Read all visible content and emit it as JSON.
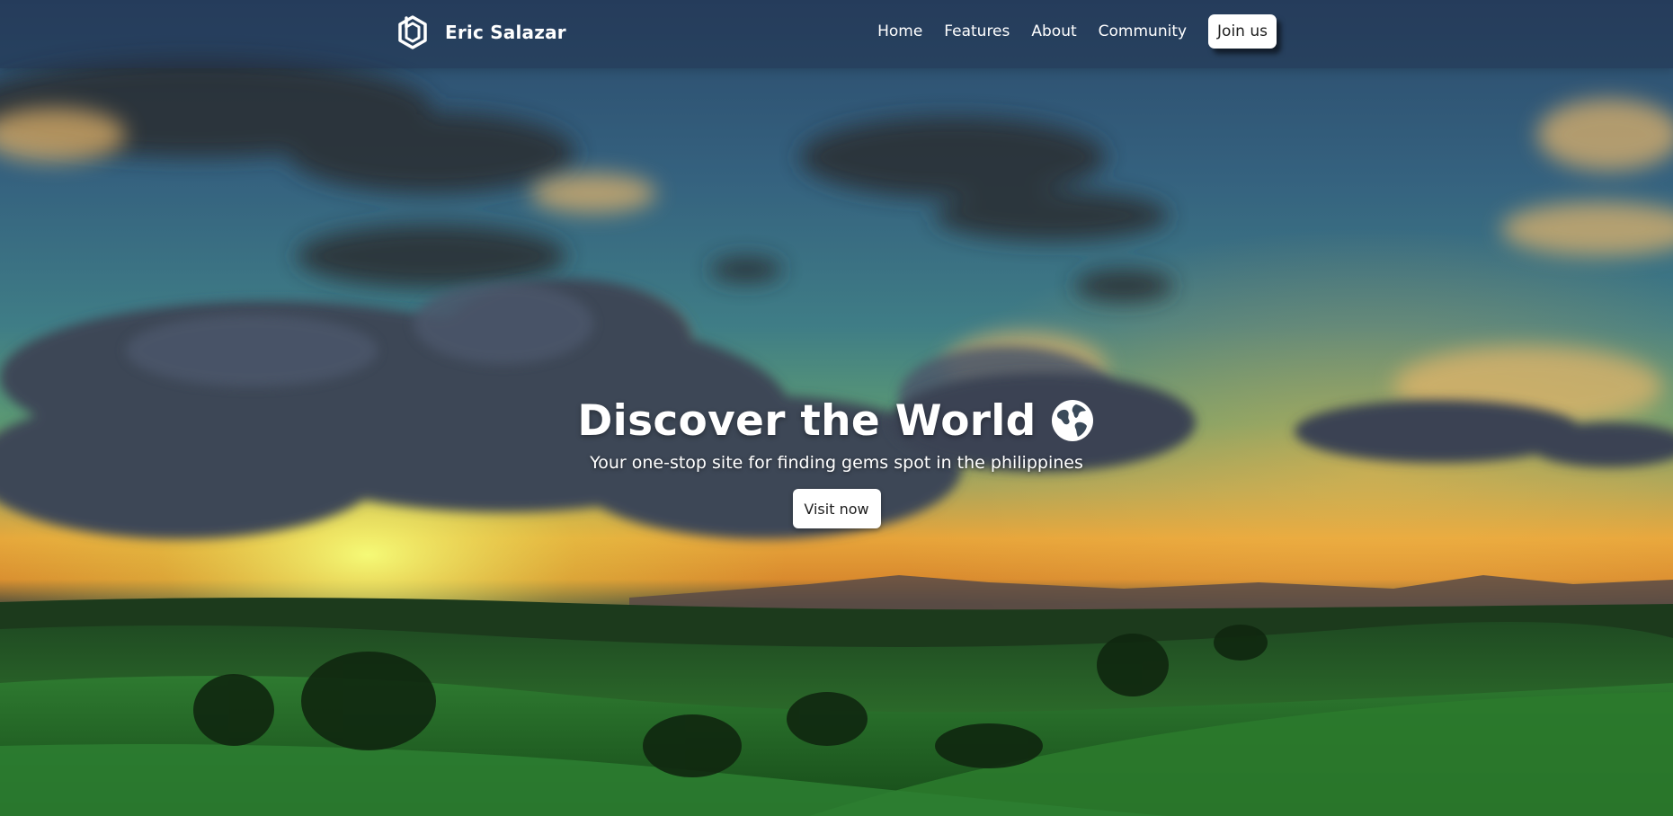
{
  "brand": {
    "name": "Eric Salazar",
    "logo_icon": "hexagon-logo-icon"
  },
  "nav": {
    "items": [
      {
        "label": "Home"
      },
      {
        "label": "Features"
      },
      {
        "label": "About"
      },
      {
        "label": "Community"
      }
    ],
    "join_label": "Join us"
  },
  "hero": {
    "title": "Discover the World",
    "title_icon": "globe-icon",
    "subtitle": "Your one-stop site for finding gems spot in the philippines",
    "cta_label": "Visit now",
    "background": "landscape-photo-sunset-over-green-hills"
  },
  "colors": {
    "text_primary": "#ffffff",
    "button_bg": "#ffffff",
    "button_text": "#1d1d1d",
    "navbar_bg": "rgba(30,45,70,0.45)"
  }
}
